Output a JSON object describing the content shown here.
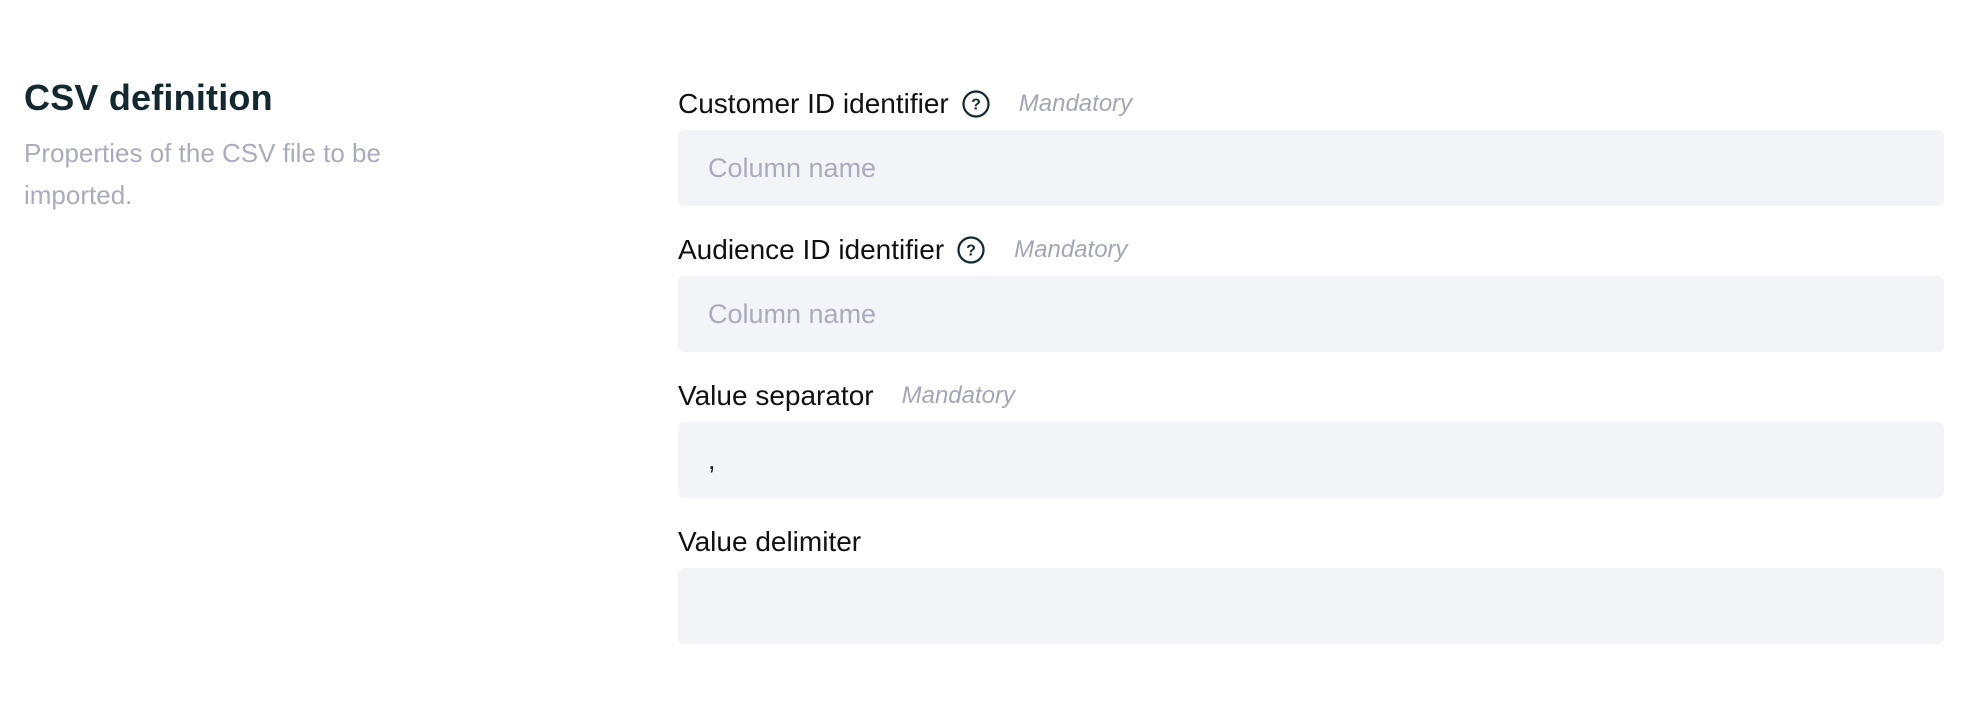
{
  "section": {
    "title": "CSV definition",
    "description": "Properties of the CSV file to be imported."
  },
  "fields": [
    {
      "label": "Customer ID identifier",
      "has_help": true,
      "help_icon": "question-circle-icon",
      "mandatory_text": "Mandatory",
      "value": "",
      "placeholder": "Column name"
    },
    {
      "label": "Audience ID identifier",
      "has_help": true,
      "help_icon": "question-circle-icon",
      "mandatory_text": "Mandatory",
      "value": "",
      "placeholder": "Column name"
    },
    {
      "label": "Value separator",
      "has_help": false,
      "mandatory_text": "Mandatory",
      "value": ",",
      "placeholder": ""
    },
    {
      "label": "Value delimiter",
      "has_help": false,
      "mandatory_text": "",
      "value": "",
      "placeholder": ""
    }
  ],
  "colors": {
    "title": "#13292f",
    "muted": "#a9adbb",
    "input_background": "#f3f4f8",
    "label": "#111111"
  }
}
